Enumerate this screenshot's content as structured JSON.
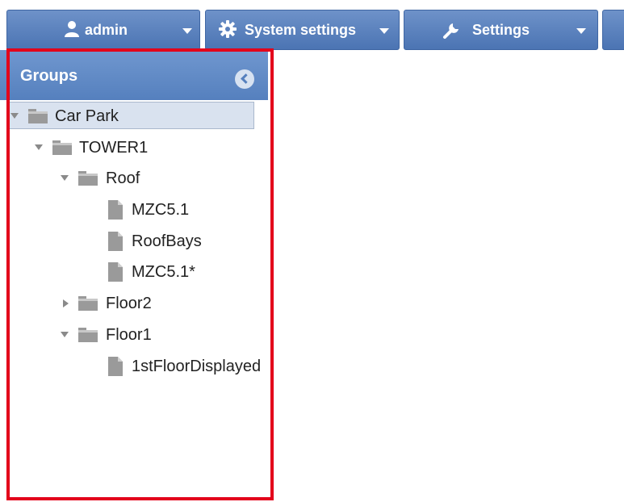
{
  "toolbar": {
    "user_menu": {
      "label": "admin",
      "icon": "user-icon"
    },
    "system_settings": {
      "label": "System settings",
      "icon": "gear-icon"
    },
    "settings": {
      "label": "Settings",
      "icon": "wrench-icon"
    }
  },
  "groups_panel": {
    "title": "Groups",
    "collapse_icon": "chevron-left-icon"
  },
  "tree": {
    "car_park": "Car Park",
    "tower1": "TOWER1",
    "roof": "Roof",
    "mzc51": "MZC5.1",
    "roofbays": "RoofBays",
    "mzc51_star": "MZC5.1*",
    "floor2": "Floor2",
    "floor1": "Floor1",
    "first_floor_displayed": "1stFloorDisplayed"
  },
  "colors": {
    "toolbar_blue": "#4b74b3",
    "panel_header_blue": "#5580be",
    "selection_bg": "#d9e2ef",
    "highlight_red": "#e3001b"
  }
}
